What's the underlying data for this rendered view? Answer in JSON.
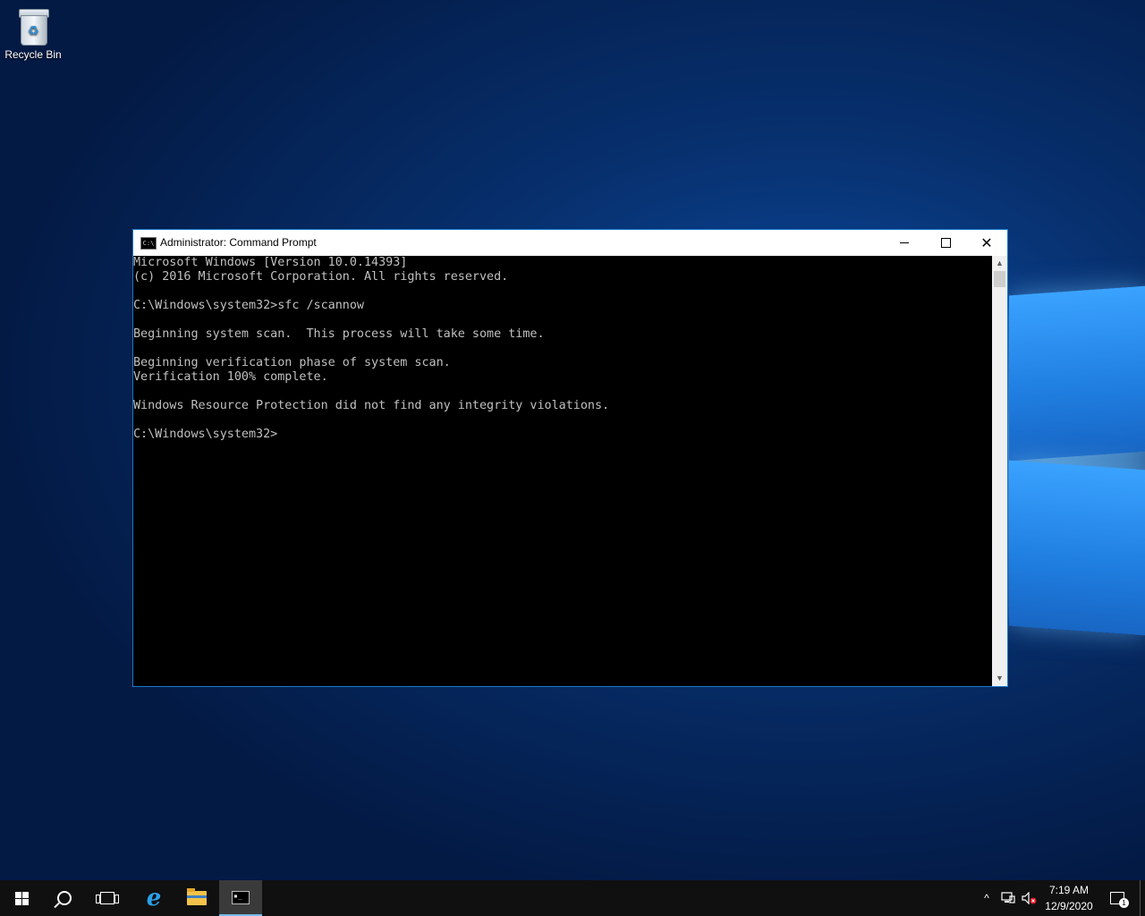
{
  "desktop": {
    "icons": [
      {
        "label": "Recycle Bin",
        "icon": "recycle-bin-icon"
      }
    ]
  },
  "window": {
    "title": "Administrator: Command Prompt",
    "icon": "cmd-icon",
    "icon_glyph": "C:\\",
    "controls": {
      "minimize": "minimize-icon",
      "maximize": "maximize-icon",
      "close_glyph": "✕"
    },
    "console_lines": [
      "Microsoft Windows [Version 10.0.14393]",
      "(c) 2016 Microsoft Corporation. All rights reserved.",
      "",
      "C:\\Windows\\system32>sfc /scannow",
      "",
      "Beginning system scan.  This process will take some time.",
      "",
      "Beginning verification phase of system scan.",
      "Verification 100% complete.",
      "",
      "Windows Resource Protection did not find any integrity violations.",
      "",
      "C:\\Windows\\system32>"
    ]
  },
  "taskbar": {
    "items": [
      "start-icon",
      "search-icon",
      "task-view-icon",
      "internet-explorer-icon",
      "file-explorer-icon",
      "command-prompt-icon"
    ],
    "active_item": "command-prompt-icon",
    "tray": {
      "chevron": "^",
      "icons": [
        "network-icon",
        "volume-muted-icon"
      ],
      "time": "7:19 AM",
      "date": "12/9/2020",
      "notification_count": "1"
    }
  },
  "colors": {
    "console_bg": "#000000",
    "console_fg": "#c0c0c0",
    "accent": "#1979ca",
    "taskbar": "#101010"
  }
}
